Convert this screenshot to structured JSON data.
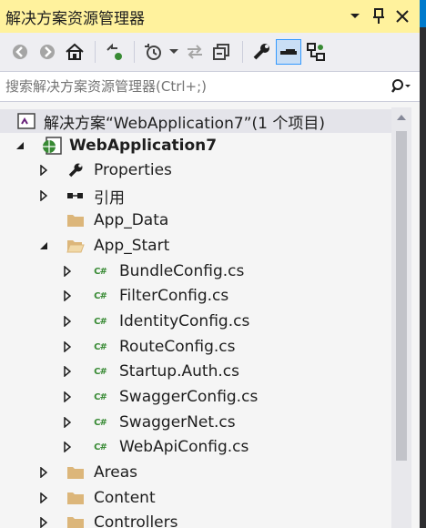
{
  "window": {
    "title": "解决方案资源管理器",
    "controls": [
      "dropdown-icon",
      "pin-icon",
      "close-icon"
    ]
  },
  "toolbar": {
    "buttons": [
      "back-icon",
      "forward-icon",
      "home-icon",
      "sync-icon",
      "history-icon",
      "history-dropdown-icon",
      "refresh-icon",
      "collapse-all-icon",
      "properties-wrench-icon",
      "preview-icon",
      "view-class-diagram-icon"
    ]
  },
  "search": {
    "placeholder": "搜索解决方案资源管理器(Ctrl+;)"
  },
  "tree": {
    "solution": "解决方案“WebApplication7”(1 个项目)",
    "project": "WebApplication7",
    "properties": "Properties",
    "references": "引用",
    "app_data": "App_Data",
    "app_start": "App_Start",
    "files": [
      "BundleConfig.cs",
      "FilterConfig.cs",
      "IdentityConfig.cs",
      "RouteConfig.cs",
      "Startup.Auth.cs",
      "SwaggerConfig.cs",
      "SwaggerNet.cs",
      "WebApiConfig.cs"
    ],
    "areas": "Areas",
    "content": "Content",
    "controllers": "Controllers",
    "cs_badge": "C#"
  },
  "colors": {
    "titlebar_bg": "#fff29d",
    "toolbar_bg": "#eeeef2",
    "folder": "#dcb67a",
    "cs_green": "#388a34",
    "selection": "#e4e4ea"
  }
}
